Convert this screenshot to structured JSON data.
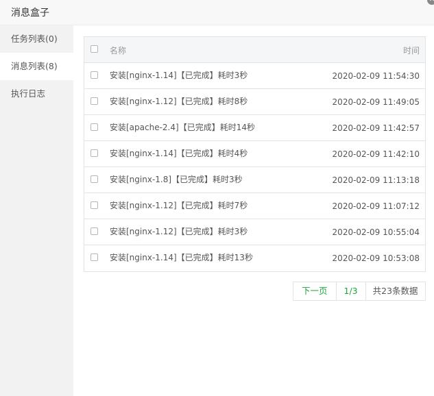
{
  "window": {
    "title": "消息盒子"
  },
  "sidebar": {
    "items": [
      {
        "label": "任务列表(0)"
      },
      {
        "label": "消息列表(8)"
      },
      {
        "label": "执行日志"
      }
    ]
  },
  "table": {
    "headers": {
      "name": "名称",
      "time": "时间"
    },
    "rows": [
      {
        "name": "安装[nginx-1.14]【已完成】耗时3秒",
        "time": "2020-02-09 11:54:30"
      },
      {
        "name": "安装[nginx-1.12]【已完成】耗时8秒",
        "time": "2020-02-09 11:49:05"
      },
      {
        "name": "安装[apache-2.4]【已完成】耗时14秒",
        "time": "2020-02-09 11:42:57"
      },
      {
        "name": "安装[nginx-1.14]【已完成】耗时4秒",
        "time": "2020-02-09 11:42:10"
      },
      {
        "name": "安装[nginx-1.8]【已完成】耗时3秒",
        "time": "2020-02-09 11:13:18"
      },
      {
        "name": "安装[nginx-1.12]【已完成】耗时7秒",
        "time": "2020-02-09 11:07:12"
      },
      {
        "name": "安装[nginx-1.12]【已完成】耗时3秒",
        "time": "2020-02-09 10:55:04"
      },
      {
        "name": "安装[nginx-1.14]【已完成】耗时13秒",
        "time": "2020-02-09 10:53:08"
      }
    ]
  },
  "pagination": {
    "next_label": "下一页",
    "page_indicator": "1/3",
    "total_label": "共23条数据"
  },
  "colors": {
    "accent": "#20a53a",
    "sidebar_bg": "#f2f2f2",
    "border": "#e3e3e3"
  }
}
